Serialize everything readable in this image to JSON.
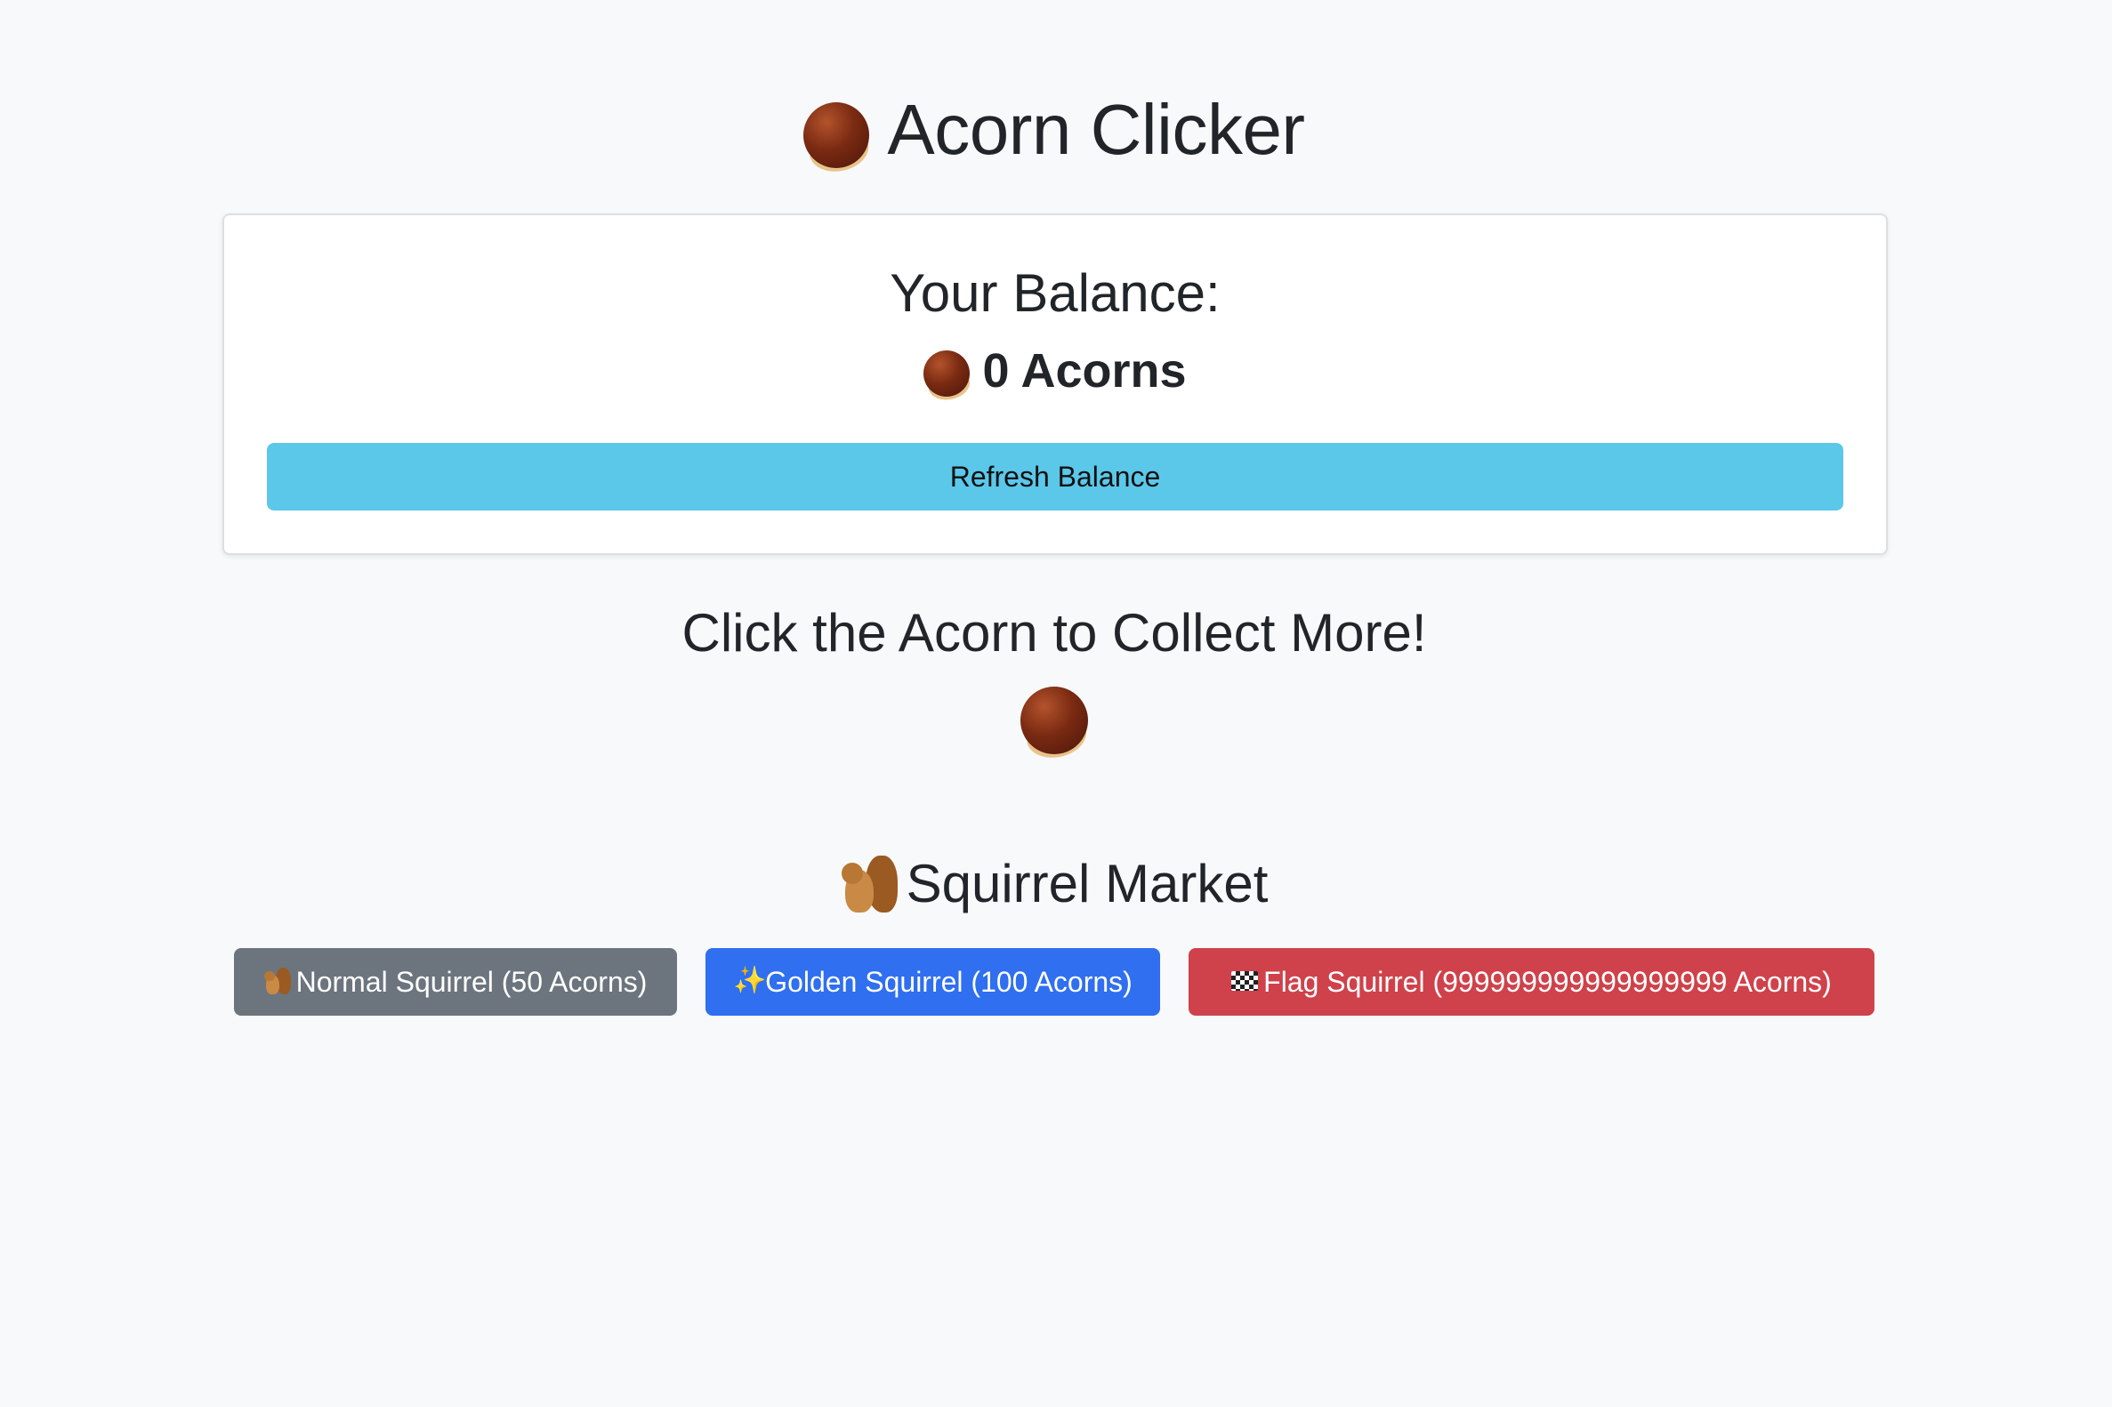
{
  "app": {
    "title": "Acorn Clicker",
    "title_icon": "chestnut-icon"
  },
  "balance": {
    "heading": "Your Balance:",
    "amount_text": "0 Acorns",
    "amount_value": 0,
    "amount_icon": "chestnut-icon",
    "refresh_label": "Refresh Balance"
  },
  "collect": {
    "heading": "Click the Acorn to Collect More!",
    "button_icon": "chestnut-icon"
  },
  "market": {
    "heading": "Squirrel Market",
    "heading_icon": "chipmunk-icon",
    "items": [
      {
        "label": "Normal Squirrel (50 Acorns)",
        "icon": "chipmunk-icon",
        "color": "#6c757d"
      },
      {
        "label": "Golden Squirrel (100 Acorns)",
        "icon": "sparkles-icon",
        "color": "#2f6ff0"
      },
      {
        "label": "Flag Squirrel (999999999999999999 Acorns)",
        "icon": "chequered-flag-icon",
        "color": "#cf424b"
      }
    ]
  },
  "colors": {
    "page_background": "#f8f9fa",
    "refresh_button": "#5bc8ea",
    "text": "#212529"
  }
}
